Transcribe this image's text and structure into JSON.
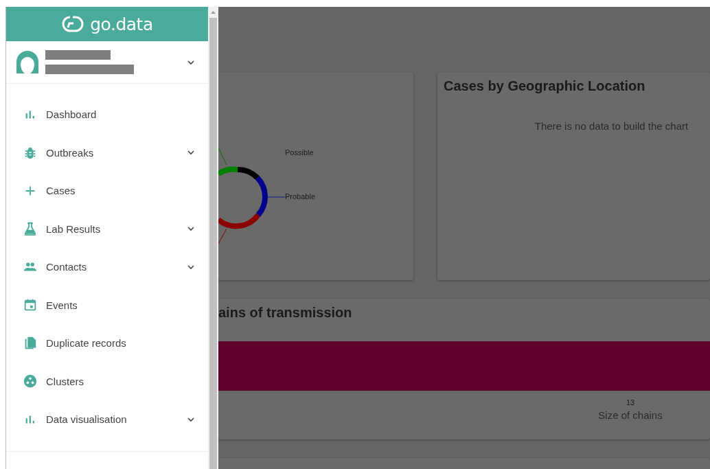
{
  "sidebar": {
    "logo": "go.data",
    "items": [
      {
        "label": "Dashboard",
        "kind": "chart",
        "expandable": false
      },
      {
        "label": "Outbreaks",
        "kind": "bug",
        "expandable": true
      },
      {
        "label": "Cases",
        "kind": "plus",
        "expandable": false
      },
      {
        "label": "Lab Results",
        "kind": "flask",
        "expandable": true
      },
      {
        "label": "Contacts",
        "kind": "people",
        "expandable": true
      },
      {
        "label": "Events",
        "kind": "calendar",
        "expandable": false
      },
      {
        "label": "Duplicate records",
        "kind": "copy",
        "expandable": false
      },
      {
        "label": "Clusters",
        "kind": "cluster",
        "expandable": false
      },
      {
        "label": "Data visualisation",
        "kind": "chart",
        "expandable": true
      }
    ]
  },
  "cards": [
    {
      "kind": "donut",
      "labels": [
        "Possible",
        "Probable"
      ]
    },
    {
      "kind": "empty",
      "title": "Cases by Geographic Location",
      "message": "There is no data to build the chart"
    },
    {
      "kind": "bar",
      "title": "ains of transmission",
      "tick": "13",
      "xlabel": "Size of chains"
    }
  ]
}
